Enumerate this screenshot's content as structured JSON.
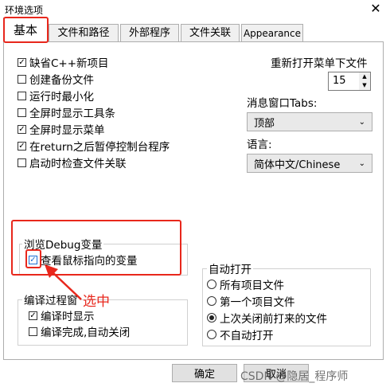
{
  "window": {
    "title": "环境选项",
    "close_glyph": "✕"
  },
  "tabs": [
    {
      "label": "基本"
    },
    {
      "label": "文件和路径"
    },
    {
      "label": "外部程序"
    },
    {
      "label": "文件关联"
    },
    {
      "label": "Appearance"
    }
  ],
  "options": [
    {
      "label": "缺省C++新项目",
      "checked": true
    },
    {
      "label": "创建备份文件",
      "checked": false
    },
    {
      "label": "运行时最小化",
      "checked": false
    },
    {
      "label": "全屏时显示工具条",
      "checked": false
    },
    {
      "label": "全屏时显示菜单",
      "checked": true
    },
    {
      "label": "在return之后暂停控制台程序",
      "checked": true
    },
    {
      "label": "启动时检查文件关联",
      "checked": false
    }
  ],
  "reopen": {
    "label": "重新打开菜单下文件",
    "value": "15"
  },
  "msg_window": {
    "label": "消息窗口Tabs:",
    "selected": "顶部"
  },
  "language": {
    "label": "语言:",
    "selected": "简体中文/Chinese"
  },
  "debug_group": {
    "title": "浏览Debug变量",
    "option": {
      "label": "查看鼠标指向的变量",
      "checked": true
    }
  },
  "compile_group": {
    "title": "编译过程窗",
    "options": [
      {
        "label": "编译时显示",
        "checked": true
      },
      {
        "label": "编译完成,自动关闭",
        "checked": false
      }
    ]
  },
  "autoopen_group": {
    "title": "自动打开",
    "options": [
      {
        "label": "所有项目文件",
        "selected": false
      },
      {
        "label": "第一个项目文件",
        "selected": false
      },
      {
        "label": "上次关闭前打来的文件",
        "selected": true
      },
      {
        "label": "不自动打开",
        "selected": false
      }
    ]
  },
  "annotation": {
    "text": "选中"
  },
  "buttons": {
    "ok": "确定",
    "cancel": "取消"
  },
  "watermark": "CSDN @隐居_程序师",
  "colors": {
    "annotation": "#e8271c"
  }
}
